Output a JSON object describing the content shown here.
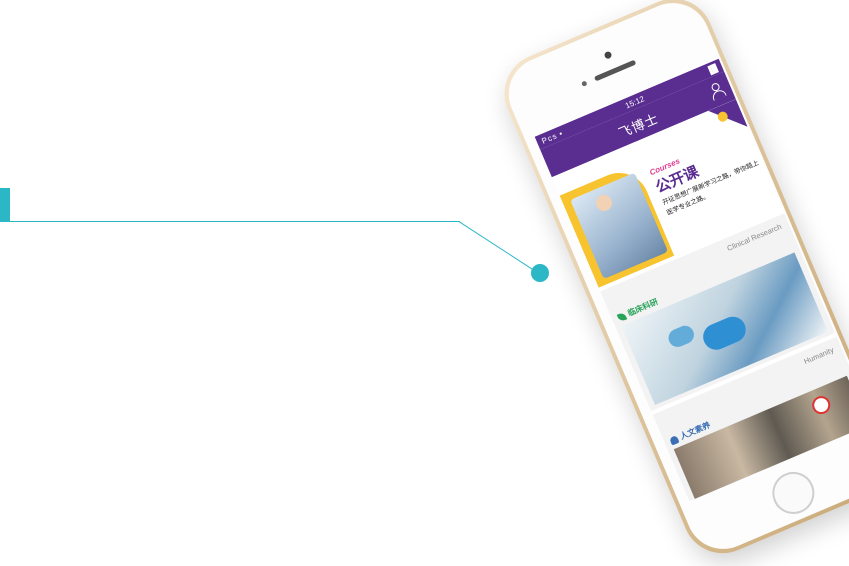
{
  "colors": {
    "accent": "#2bb7c6",
    "brand_purple": "#5a2d91",
    "banner_yellow": "#f7c32e",
    "courses_pink": "#e03a8f",
    "clinical_green": "#2aa35a",
    "humanity_blue": "#3a6fb5",
    "phone_gold": "#d9bf95"
  },
  "phone": {
    "status_bar": {
      "carrier": "Pcs •",
      "time": "15:12",
      "battery": "▐█"
    },
    "nav_bar": {
      "title": "飞博士",
      "user_icon": "user-icon"
    },
    "banner": {
      "label_en": "Courses",
      "label_zh": "公开课",
      "description": "开征思想广展新学习之路，带你踏上医学专业之路。"
    },
    "sections": [
      {
        "label_en": "Clinical Research",
        "label_zh": "临床科研",
        "icon": "leaf-icon"
      },
      {
        "label_en": "Humanity",
        "label_zh": "人文素养",
        "icon": "person-icon"
      }
    ]
  }
}
